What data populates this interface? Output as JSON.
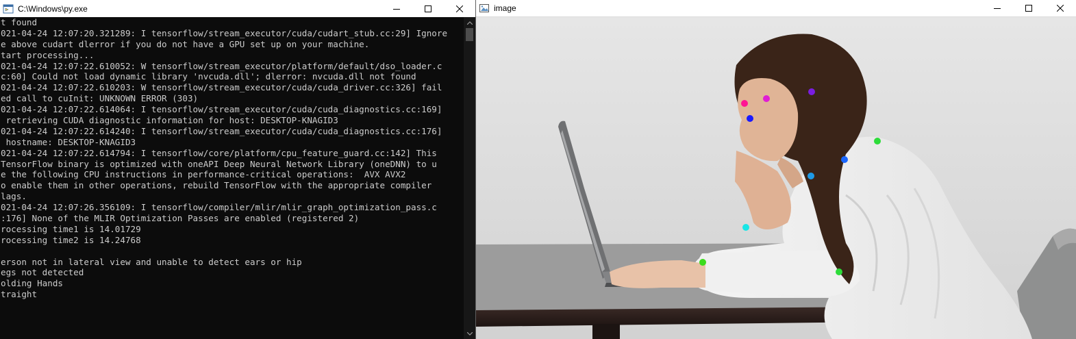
{
  "console": {
    "title": "C:\\Windows\\py.exe",
    "lines": [
      "t found",
      "021-04-24 12:07:20.321289: I tensorflow/stream_executor/cuda/cudart_stub.cc:29] Ignore",
      "e above cudart dlerror if you do not have a GPU set up on your machine.",
      "tart processing...",
      "021-04-24 12:07:22.610052: W tensorflow/stream_executor/platform/default/dso_loader.c",
      "c:60] Could not load dynamic library 'nvcuda.dll'; dlerror: nvcuda.dll not found",
      "021-04-24 12:07:22.610203: W tensorflow/stream_executor/cuda/cuda_driver.cc:326] fail",
      "ed call to cuInit: UNKNOWN ERROR (303)",
      "021-04-24 12:07:22.614064: I tensorflow/stream_executor/cuda/cuda_diagnostics.cc:169]",
      " retrieving CUDA diagnostic information for host: DESKTOP-KNAGID3",
      "021-04-24 12:07:22.614240: I tensorflow/stream_executor/cuda/cuda_diagnostics.cc:176]",
      " hostname: DESKTOP-KNAGID3",
      "021-04-24 12:07:22.614794: I tensorflow/core/platform/cpu_feature_guard.cc:142] This",
      "TensorFlow binary is optimized with oneAPI Deep Neural Network Library (oneDNN) to u",
      "e the following CPU instructions in performance-critical operations:  AVX AVX2",
      "o enable them in other operations, rebuild TensorFlow with the appropriate compiler",
      "lags.",
      "021-04-24 12:07:26.356109: I tensorflow/compiler/mlir/mlir_graph_optimization_pass.c",
      ":176] None of the MLIR Optimization Passes are enabled (registered 2)",
      "rocessing time1 is 14.01729",
      "rocessing time2 is 14.24768",
      "",
      "erson not in lateral view and unable to detect ears or hip",
      "egs not detected",
      "olding Hands",
      "traight"
    ]
  },
  "image_window": {
    "title": "image",
    "keypoints": [
      {
        "name": "right-ear",
        "color": "#7a1de0"
      },
      {
        "name": "right-eye",
        "color": "#e01dd4"
      },
      {
        "name": "left-eye",
        "color": "#ff1493"
      },
      {
        "name": "nose",
        "color": "#1a1aff"
      },
      {
        "name": "right-shoulder",
        "color": "#2ddc3a"
      },
      {
        "name": "neck",
        "color": "#1a66ff"
      },
      {
        "name": "chest",
        "color": "#1e9ae6"
      },
      {
        "name": "left-arm",
        "color": "#19e6e6"
      },
      {
        "name": "left-wrist",
        "color": "#3cdc1e"
      },
      {
        "name": "right-elbow",
        "color": "#2ddc3a"
      }
    ]
  },
  "colors": {
    "console_bg": "#0c0c0c",
    "console_text": "#cccccc"
  }
}
